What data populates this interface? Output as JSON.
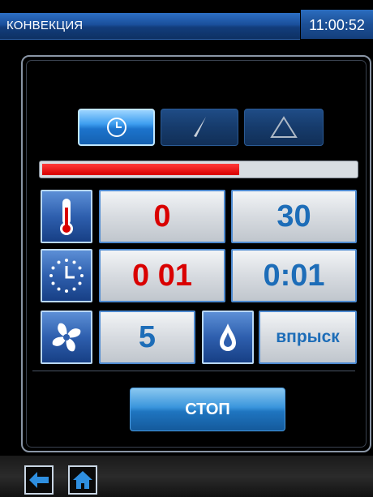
{
  "header": {
    "title": "КОНВЕКЦИЯ",
    "clock": "11:00:52"
  },
  "modes": [
    {
      "name": "timer",
      "icon": "clock-icon",
      "active": true
    },
    {
      "name": "probe",
      "icon": "probe-icon",
      "active": false
    },
    {
      "name": "delta",
      "icon": "delta-icon",
      "active": false
    }
  ],
  "progress": {
    "fraction": 0.63,
    "color": "#e00000"
  },
  "temperature": {
    "icon": "thermometer-icon",
    "current": "0",
    "set": "30"
  },
  "time": {
    "icon": "timer-clock-icon",
    "current": "0 01",
    "set": "0:01"
  },
  "fan": {
    "icon": "fan-icon",
    "value": "5"
  },
  "steam": {
    "icon": "water-drop-icon",
    "label": "впрыск"
  },
  "stop_label": "СТОП",
  "nav": {
    "back_icon": "arrow-left-icon",
    "home_icon": "home-icon"
  },
  "colors": {
    "accent": "#1d6db8",
    "alert": "#d90000"
  }
}
